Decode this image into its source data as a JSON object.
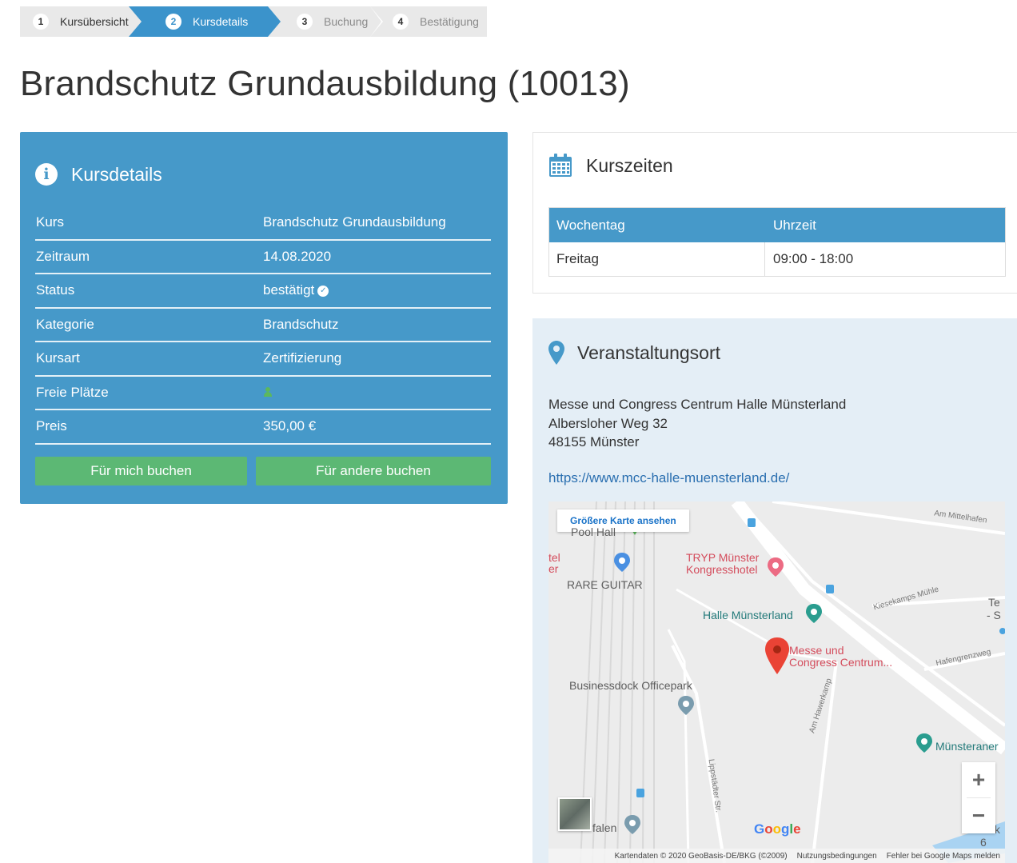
{
  "stepper": [
    {
      "num": "1",
      "label": "Kursübersicht"
    },
    {
      "num": "2",
      "label": "Kursdetails"
    },
    {
      "num": "3",
      "label": "Buchung"
    },
    {
      "num": "4",
      "label": "Bestätigung"
    }
  ],
  "page_title": "Brandschutz Grundausbildung (10013)",
  "details": {
    "title": "Kursdetails",
    "rows": [
      {
        "key": "Kurs",
        "value": "Brandschutz Grundausbildung"
      },
      {
        "key": "Zeitraum",
        "value": "14.08.2020"
      },
      {
        "key": "Status",
        "value": "bestätigt"
      },
      {
        "key": "Kategorie",
        "value": "Brandschutz"
      },
      {
        "key": "Kursart",
        "value": "Zertifizierung"
      },
      {
        "key": "Freie Plätze",
        "value": ""
      },
      {
        "key": "Preis",
        "value": "350,00 €"
      }
    ],
    "btn_self": "Für mich buchen",
    "btn_other": "Für andere buchen"
  },
  "times": {
    "title": "Kurszeiten",
    "headers": [
      "Wochentag",
      "Uhrzeit"
    ],
    "rows": [
      {
        "day": "Freitag",
        "time": "09:00 - 18:00"
      }
    ]
  },
  "venue": {
    "title": "Veranstaltungsort",
    "address": [
      "Messe und Congress Centrum Halle Münsterland",
      "Albersloher Weg 32",
      "48155 Münster"
    ],
    "url": "https://www.mcc-halle-muensterland.de/"
  },
  "map": {
    "bigger_map": "Größere Karte ansehen",
    "labels": {
      "tryp": "TRYP Münster",
      "tryp2": "Kongresshotel",
      "rare": "RARE GUITAR",
      "halle": "Halle Münsterland",
      "messe": "Messe und",
      "messe2": "Congress Centrum...",
      "business": "Businessdock Officepark",
      "muensteraner": "Münsteraner",
      "am_mittelhafen": "Am Mittelhafen",
      "kiesekamps": "Kiesekamps Mühle",
      "hafenweg": "Hafengrenzweg",
      "hawerkamp": "Am Hawerkamp",
      "lippstaedter": "Lippstädter Str.",
      "falen": "falen",
      "tel": "tel",
      "er": "er",
      "dek": "Dek 6",
      "te": "Te",
      "s": "- S",
      "partial": "Pool Hall"
    },
    "google": [
      "G",
      "o",
      "o",
      "g",
      "l",
      "e"
    ],
    "attrib": [
      "Kartendaten © 2020 GeoBasis-DE/BKG (©2009)",
      "Nutzungsbedingungen",
      "Fehler bei Google Maps melden"
    ],
    "zoom_in": "+",
    "zoom_out": "−"
  }
}
